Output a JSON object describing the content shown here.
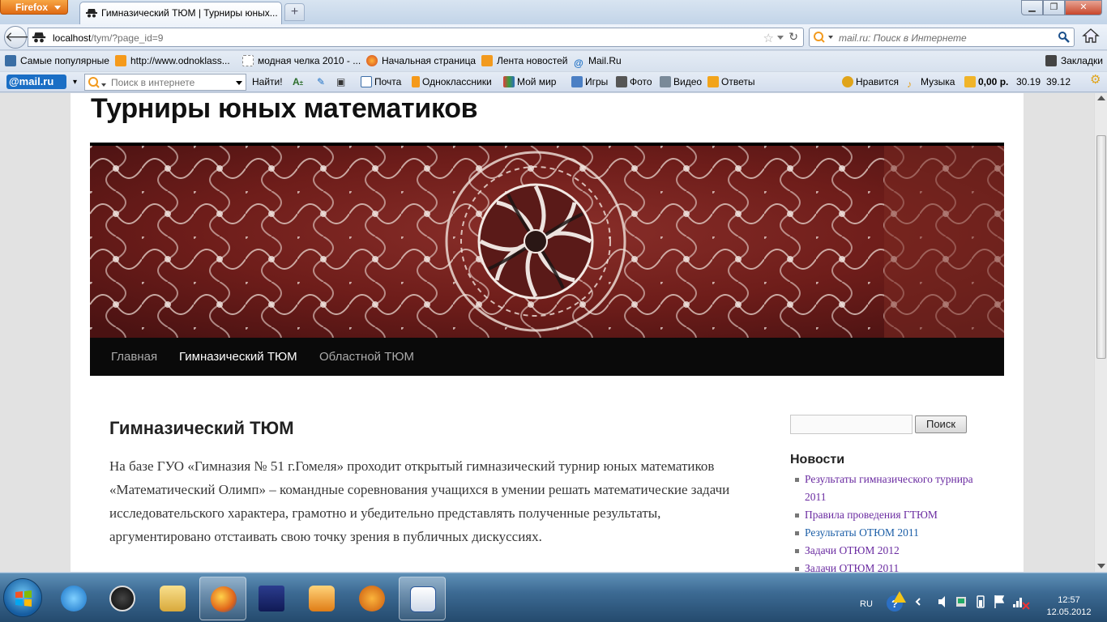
{
  "browser": {
    "app_button": "Firefox",
    "tab_title": "Гимназический ТЮМ | Турниры юных...",
    "url_host": "localhost",
    "url_path": "/tym/?page_id=9",
    "search_placeholder": "mail.ru: Поиск в Интернете"
  },
  "bookmarks": [
    {
      "label": "Самые популярные",
      "icon": "bookmark-star-icon",
      "color": "#3a6ea5"
    },
    {
      "label": "http://www.odnoklass...",
      "icon": "odnoklassniki-icon",
      "color": "#f59a1b"
    },
    {
      "label": "модная челка 2010 - ...",
      "icon": "page-icon",
      "color": "#ffffff"
    },
    {
      "label": "Начальная страница",
      "icon": "firefox-icon",
      "color": "#e0651a"
    },
    {
      "label": "Лента новостей",
      "icon": "rss-icon",
      "color": "#f29a1e"
    },
    {
      "label": "Mail.Ru",
      "icon": "at-icon",
      "color": "#1a6ec5"
    }
  ],
  "bookmarks_menu": "Закладки",
  "mailbar": {
    "logo": "@mail.ru",
    "search_placeholder": "Поиск в интернете",
    "find_button": "Найти!",
    "links": [
      {
        "label": "Почта",
        "icon": "mail-icon"
      },
      {
        "label": "Одноклассники",
        "icon": "odnoklassniki-icon"
      },
      {
        "label": "Мой мир",
        "icon": "people-icon"
      },
      {
        "label": "Игры",
        "icon": "games-icon"
      },
      {
        "label": "Фото",
        "icon": "camera-icon"
      },
      {
        "label": "Видео",
        "icon": "video-icon"
      },
      {
        "label": "Ответы",
        "icon": "answers-icon"
      }
    ],
    "right": {
      "like": "Нравится",
      "music": "Музыка",
      "balance": "0,00 р.",
      "rate1": "30.19",
      "rate2": "39.12"
    }
  },
  "site": {
    "title": "Турниры юных математиков",
    "menu": [
      {
        "label": "Главная",
        "current": false
      },
      {
        "label": "Гимназический ТЮМ",
        "current": true
      },
      {
        "label": "Областной ТЮМ",
        "current": false
      }
    ],
    "entry_title": "Гимназический ТЮМ",
    "entry_text": "На базе ГУО «Гимназия № 51 г.Гомеля» проходит  открытый гимназический  турнир юных математиков «Математический Олимп» – командные соревнования учащихся в умении решать математические задачи исследовательского характера, грамотно и убедительно представлять полученные результаты, аргументировано отстаивать свою точку зрения в публичных дискуссиях.",
    "search_button": "Поиск",
    "news_title": "Новости",
    "news": [
      {
        "label": "Результаты гимназического турнира 2011",
        "visited": true
      },
      {
        "label": "Правила проведения ГТЮМ",
        "visited": true
      },
      {
        "label": "Результаты ОТЮМ 2011",
        "visited": false
      },
      {
        "label": "Задачи ОТЮМ 2012",
        "visited": true
      },
      {
        "label": "Задачи ОТЮМ 2011",
        "visited": true
      }
    ]
  },
  "taskbar": {
    "lang": "RU",
    "time": "12:57",
    "date": "12.05.2012"
  }
}
